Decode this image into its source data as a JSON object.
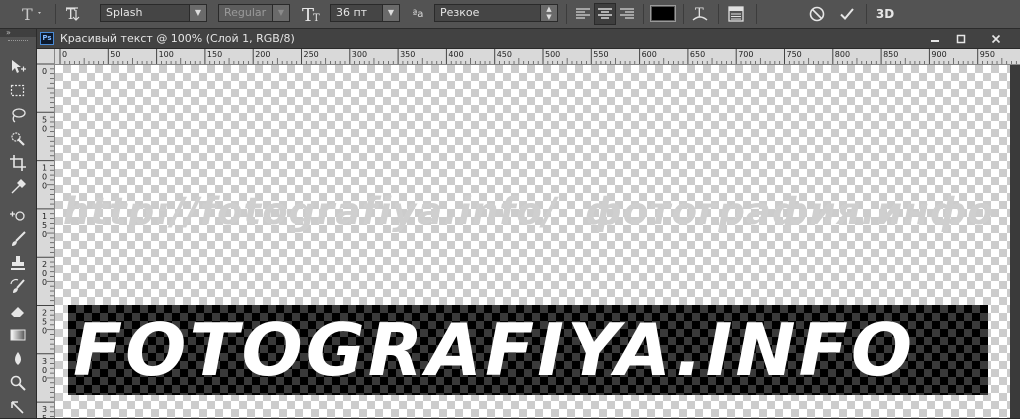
{
  "options_bar": {
    "font_family": "Splash",
    "font_style": "Regular",
    "font_size": "36 пт",
    "antialias": "Резкое",
    "three_d_label": "3D",
    "text_color": "#000000",
    "font_size_icon_glyph": "T",
    "antialias_icon_glyph": "ªa"
  },
  "document": {
    "title": "Красивый текст @ 100% (Слой 1, RGB/8)",
    "ps_badge": "Ps"
  },
  "ruler": {
    "h_ticks": [
      "0",
      "50",
      "100",
      "150",
      "200",
      "250",
      "300",
      "350",
      "400",
      "450",
      "500",
      "550",
      "600",
      "650",
      "700",
      "750",
      "800",
      "850",
      "900",
      "950"
    ],
    "v_ticks": [
      "0",
      "5\n0",
      "1\n0\n0",
      "1\n5\n0",
      "2\n0\n0",
      "2\n5\n0",
      "3\n0\n0",
      "3\n5\n0"
    ]
  },
  "canvas": {
    "watermark_left": "http://fotografiya.info/",
    "watermark_right": "фотография.инфо",
    "main_text": "FOTOGRAFIYA.INFO"
  }
}
